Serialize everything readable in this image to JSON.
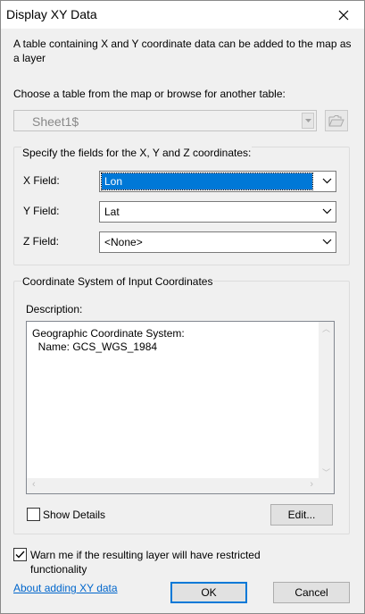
{
  "window": {
    "title": "Display XY Data",
    "close_icon": "close-icon"
  },
  "intro_text": "A table containing X and Y coordinate data can be added to the map as a layer",
  "table_section": {
    "label": "Choose a table from the map or browse for another table:",
    "selected_table": "Sheet1$",
    "browse_icon": "open-folder-icon"
  },
  "fields_group": {
    "label": "Specify the fields for the X, Y and Z coordinates:",
    "x_label": "X Field:",
    "x_value": "Lon",
    "y_label": "Y Field:",
    "y_value": "Lat",
    "z_label": "Z Field:",
    "z_value": "<None>"
  },
  "coord_group": {
    "label": "Coordinate System of Input Coordinates",
    "description_label": "Description:",
    "description_text": "Geographic Coordinate System:\n  Name: GCS_WGS_1984",
    "show_details_label": "Show Details",
    "show_details_checked": false,
    "edit_label": "Edit..."
  },
  "warn": {
    "label": "Warn me if the resulting layer will have restricted functionality",
    "checked": true
  },
  "footer": {
    "help_link": "About adding XY data",
    "ok_label": "OK",
    "cancel_label": "Cancel"
  }
}
